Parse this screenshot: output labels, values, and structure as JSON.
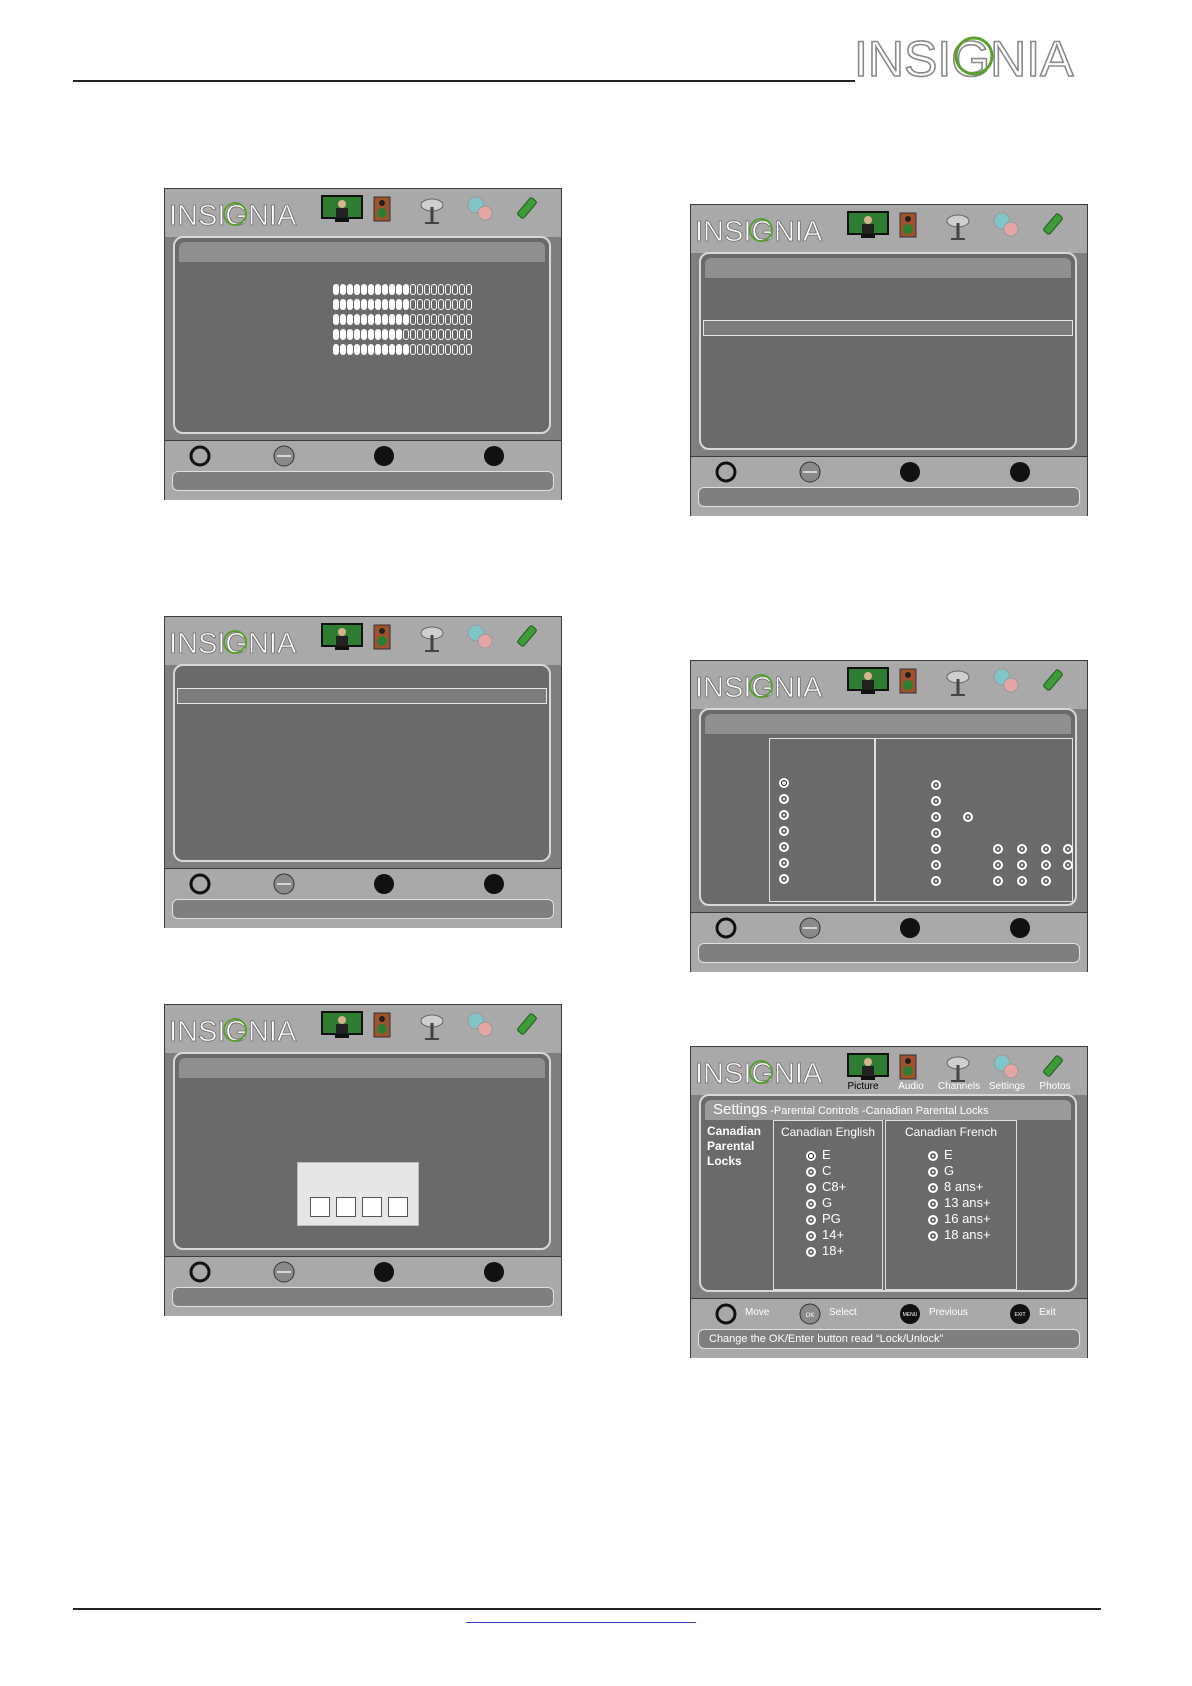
{
  "brand": {
    "logo_text": "INSIGNIA"
  },
  "osd": {
    "logo_text": "INSIGNIA",
    "tabs": [
      {
        "name": "picture",
        "label": "Picture",
        "icon": "picture-icon"
      },
      {
        "name": "audio",
        "label": "Audio",
        "icon": "speaker-icon"
      },
      {
        "name": "channels",
        "label": "Channels",
        "icon": "antenna-icon"
      },
      {
        "name": "settings",
        "label": "Settings",
        "icon": "settings-icon"
      },
      {
        "name": "photos",
        "label": "Photos",
        "icon": "usb-icon"
      }
    ]
  },
  "screen_last": {
    "title_main": "Settings",
    "title_path": " -Parental Controls -Canadian Parental Locks",
    "side_label": "Canadian Parental Locks",
    "english": {
      "title": "Canadian English",
      "options": [
        "E",
        "C",
        "C8+",
        "G",
        "PG",
        "14+",
        "18+"
      ],
      "selected": 0
    },
    "french": {
      "title": "Canadian French",
      "options": [
        "E",
        "G",
        "8 ans+",
        "13 ans+",
        "16 ans+",
        "18 ans+"
      ]
    },
    "controls": [
      {
        "label": "Move",
        "icon": "move-icon"
      },
      {
        "label": "Select",
        "icon": "ok-enter-icon",
        "badge": "OK ENTER"
      },
      {
        "label": "Previous",
        "icon": "menu-icon",
        "badge": "MENU"
      },
      {
        "label": "Exit",
        "icon": "exit-icon",
        "badge": "EXIT"
      }
    ],
    "hint": "Change the OK/Enter button read “Lock/Unlock”"
  },
  "colors": {
    "osd_frame": "#a9a9a9",
    "osd_panel": "#6a6a6a",
    "picture_tab_bg": "#2f7d32",
    "logo_green": "#5aa02c"
  }
}
